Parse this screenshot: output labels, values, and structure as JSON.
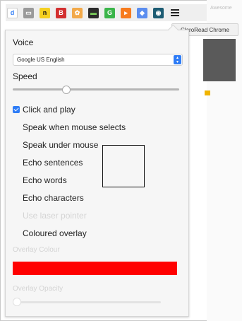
{
  "toolbar": {
    "extensions": [
      {
        "name": "ext-d",
        "glyph": "d",
        "bg": "#ffffff",
        "fg": "#2e7cf6"
      },
      {
        "name": "ext-gray",
        "glyph": "▭",
        "bg": "#9a9a9a",
        "fg": "#ffffff"
      },
      {
        "name": "ext-n",
        "glyph": "n",
        "bg": "#f5d021",
        "fg": "#111111"
      },
      {
        "name": "ext-b",
        "glyph": "B",
        "bg": "#d32f2f",
        "fg": "#ffffff"
      },
      {
        "name": "ext-palette",
        "glyph": "✿",
        "bg": "#f2a94a",
        "fg": "#ffffff"
      },
      {
        "name": "ext-terminal",
        "glyph": "▬",
        "bg": "#2b2b2b",
        "fg": "#7ccf5c"
      },
      {
        "name": "ext-green",
        "glyph": "G",
        "bg": "#3bb54a",
        "fg": "#ffffff"
      },
      {
        "name": "ext-orange",
        "glyph": "▸",
        "bg": "#f77b1e",
        "fg": "#ffffff"
      },
      {
        "name": "ext-blue",
        "glyph": "◆",
        "bg": "#5b8def",
        "fg": "#ffffff"
      },
      {
        "name": "ext-claroread",
        "glyph": "◉",
        "bg": "#1d5c73",
        "fg": "#ffffff"
      }
    ],
    "tooltip": "ClaroRead Chrome"
  },
  "browser": {
    "right_title": "Awesome"
  },
  "panel": {
    "voice_label": "Voice",
    "voice_select": "Google US English",
    "speed_label": "Speed",
    "speed_value": 0.32,
    "options": [
      {
        "label": "Click and play",
        "checked": true,
        "faded": false
      },
      {
        "label": "Speak when mouse selects",
        "checked": false,
        "faded": false
      },
      {
        "label": "Speak under mouse",
        "checked": false,
        "faded": false
      },
      {
        "label": "Echo sentences",
        "checked": false,
        "faded": false
      },
      {
        "label": "Echo words",
        "checked": false,
        "faded": false
      },
      {
        "label": "Echo characters",
        "checked": false,
        "faded": false
      },
      {
        "label": "Use laser pointer",
        "checked": false,
        "faded": true
      },
      {
        "label": "Coloured overlay",
        "checked": false,
        "faded": false
      }
    ],
    "overlay_colour_label": "Overlay Colour",
    "overlay_colour": "#ff0000",
    "overlay_opacity_label": "Overlay Opacity",
    "overlay_opacity_value": 0.0
  }
}
